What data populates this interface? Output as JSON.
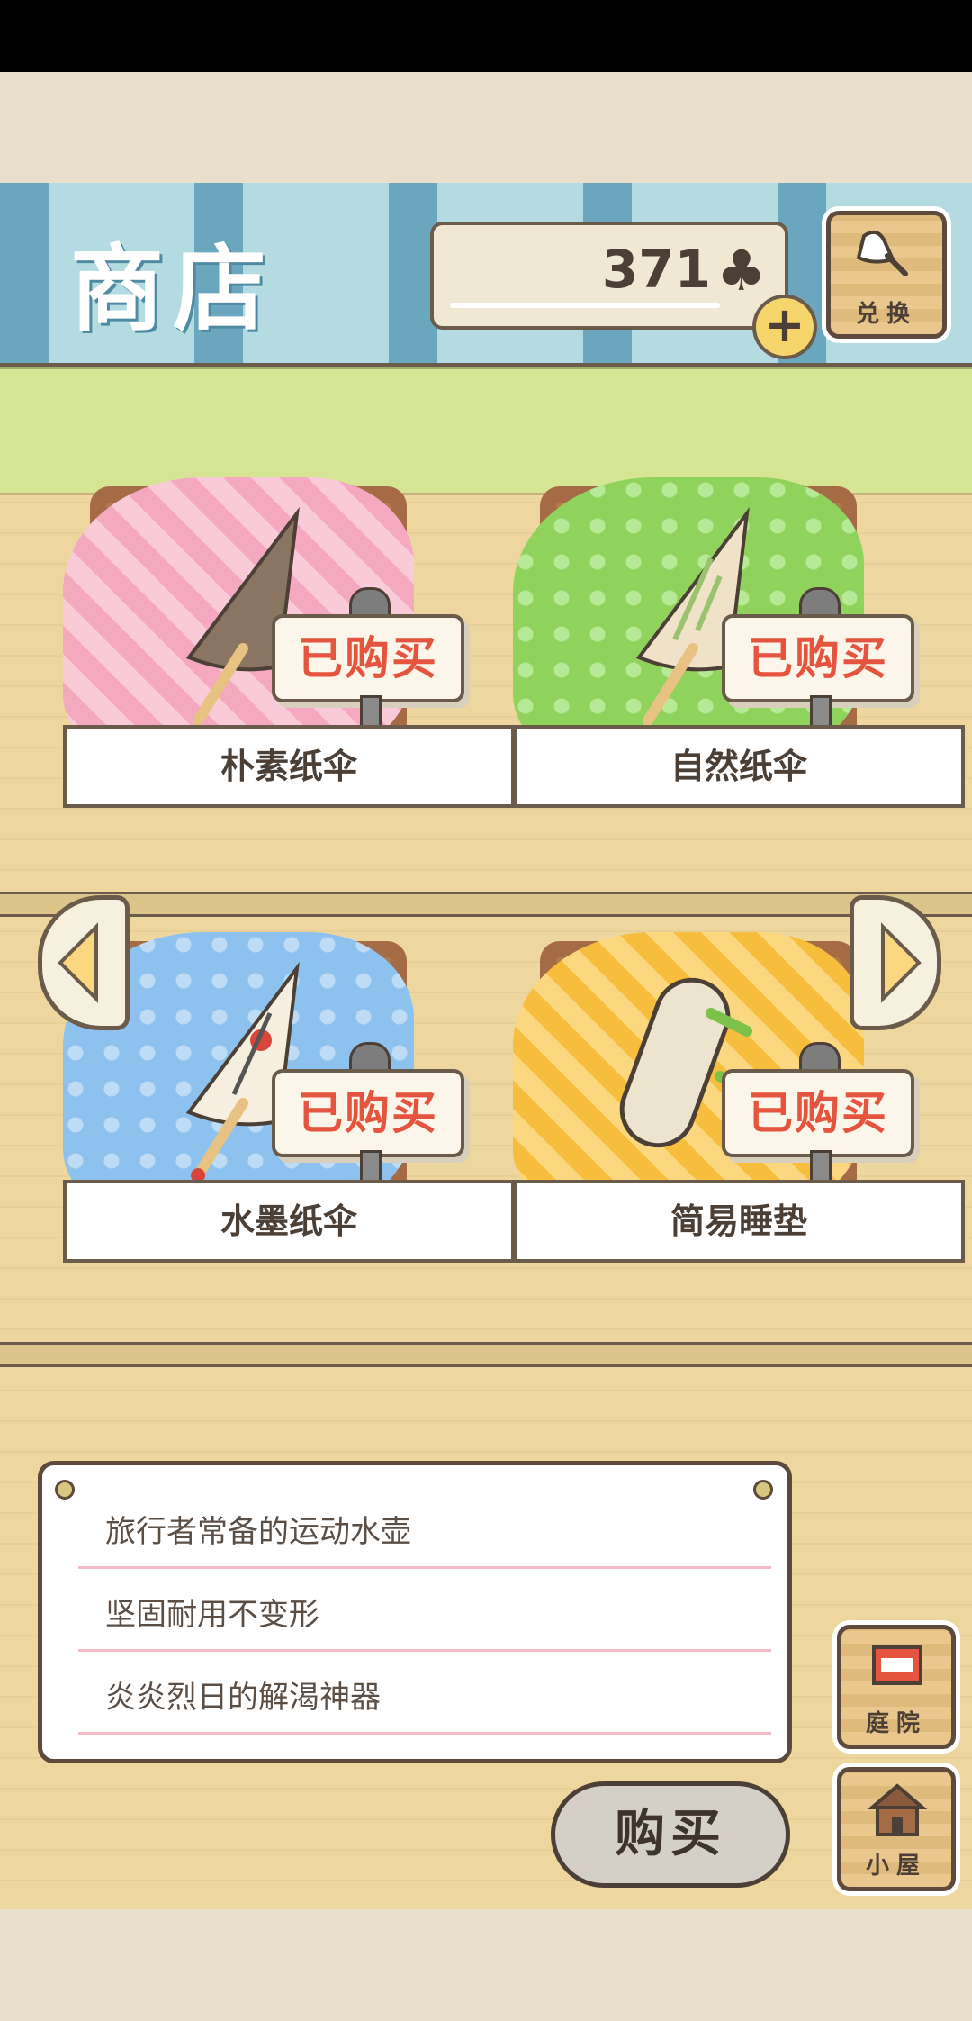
{
  "header": {
    "title": "商店",
    "coins": "371",
    "currency_icon": "clover-icon",
    "plus_icon": "plus-icon",
    "exchange_label": "兑换"
  },
  "items": [
    {
      "name": "朴素纸伞",
      "status": "已购买",
      "cloth_color": "#f4a9c0",
      "item_color": "#8a7462"
    },
    {
      "name": "自然纸伞",
      "status": "已购买",
      "cloth_color": "#8fd35d",
      "item_color": "#efe2c8"
    },
    {
      "name": "水墨纸伞",
      "status": "已购买",
      "cloth_color": "#8dc1ee",
      "item_color": "#f6efe0"
    },
    {
      "name": "简易睡垫",
      "status": "已购买",
      "cloth_color": "#f7bd3c",
      "item_color": "#ece4cf"
    }
  ],
  "description": {
    "lines": [
      "旅行者常备的运动水壶",
      "坚固耐用不变形",
      "炎炎烈日的解渴神器"
    ]
  },
  "buy_label": "购买",
  "nav": {
    "yard_label": "庭院",
    "house_label": "小屋"
  },
  "colors": {
    "awning_dark": "#6aa7bf",
    "awning_light": "#b3dbe1",
    "wood": "#edd79e",
    "sold_text": "#e4543e"
  }
}
